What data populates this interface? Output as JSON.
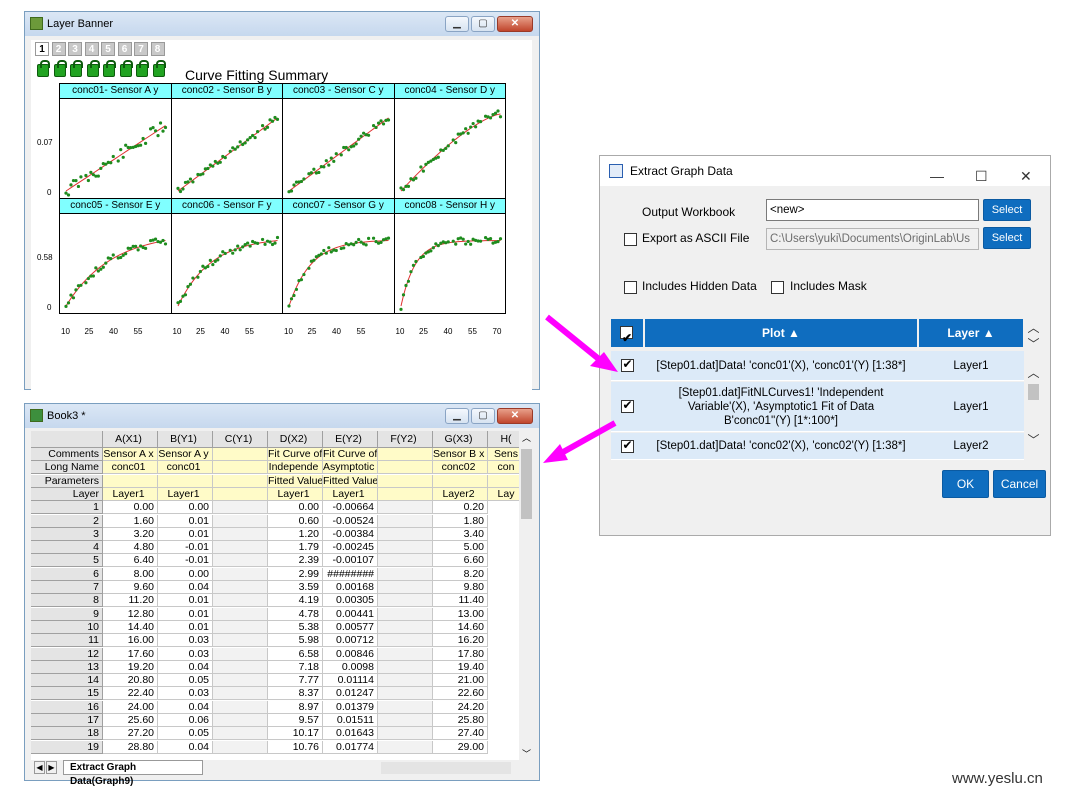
{
  "graph_window": {
    "title": "Layer Banner",
    "layer_tabs": [
      "1",
      "2",
      "3",
      "4",
      "5",
      "6",
      "7",
      "8"
    ],
    "chart_title": "Curve Fitting Summary"
  },
  "chart_data": {
    "type": "scatter",
    "title": "Curve Fitting Summary",
    "panels": [
      {
        "name": "conc01- Sensor A y",
        "row": 1
      },
      {
        "name": "conc02 - Sensor B y",
        "row": 1
      },
      {
        "name": "conc03 - Sensor C y",
        "row": 1
      },
      {
        "name": "conc04 - Sensor D y",
        "row": 1
      },
      {
        "name": "conc05 - Sensor E y",
        "row": 2
      },
      {
        "name": "conc06 - Sensor F y",
        "row": 2
      },
      {
        "name": "conc07 - Sensor G y",
        "row": 2
      },
      {
        "name": "conc08 - Sensor H y",
        "row": 2
      }
    ],
    "row1_yticks": [
      "0.07",
      "0"
    ],
    "row2_yticks": [
      "0.58",
      "0"
    ],
    "xticks": [
      "10",
      "25",
      "40",
      "55",
      "70"
    ],
    "series_colors": {
      "points": "#1e8c1e",
      "fit": "#e03030"
    }
  },
  "dialog": {
    "title": "Extract Graph Data",
    "output_workbook_label": "Output Workbook",
    "output_workbook_value": "<new>",
    "select_label": "Select",
    "export_ascii_label": "Export as ASCII File",
    "ascii_path": "C:\\Users\\yuki\\Documents\\OriginLab\\Us",
    "hidden_data_label": "Includes Hidden Data",
    "mask_label": "Includes Mask",
    "col_plot": "Plot",
    "col_layer": "Layer",
    "rows": [
      {
        "plot": "[Step01.dat]Data! 'conc01'(X), 'conc01'(Y) [1:38*]",
        "layer": "Layer1",
        "checked": true
      },
      {
        "plot": "[Step01.dat]FitNLCurves1! 'Independent Variable'(X), 'Asymptotic1 Fit of Data B'conc01''(Y) [1*:100*]",
        "layer": "Layer1",
        "checked": true
      },
      {
        "plot": "[Step01.dat]Data! 'conc02'(X), 'conc02'(Y) [1:38*]",
        "layer": "Layer2",
        "checked": true
      }
    ],
    "ok_label": "OK",
    "cancel_label": "Cancel"
  },
  "book": {
    "title": "Book3 *",
    "columns": [
      "A(X1)",
      "B(Y1)",
      "C(Y1)",
      "D(X2)",
      "E(Y2)",
      "F(Y2)",
      "G(X3)",
      "H("
    ],
    "meta_rows": [
      {
        "label": "Comments",
        "cells": [
          "Sensor A x",
          "Sensor A y",
          "",
          "Fit Curve of",
          "Fit Curve of",
          "",
          "Sensor B x",
          "Sens"
        ]
      },
      {
        "label": "Long Name",
        "cells": [
          "conc01",
          "conc01",
          "",
          "Independe",
          "Asymptotic",
          "",
          "conc02",
          "con"
        ]
      },
      {
        "label": "Parameters",
        "cells": [
          "",
          "",
          "",
          "Fitted Values",
          "Fitted Values",
          "",
          "",
          ""
        ]
      },
      {
        "label": "Layer",
        "cells": [
          "Layer1",
          "Layer1",
          "",
          "Layer1",
          "Layer1",
          "",
          "Layer2",
          "Lay"
        ]
      }
    ],
    "rows": [
      [
        "1",
        "0.00",
        "0.00",
        "",
        "0.00",
        "-0.00664",
        "",
        "0.20"
      ],
      [
        "2",
        "1.60",
        "0.01",
        "",
        "0.60",
        "-0.00524",
        "",
        "1.80"
      ],
      [
        "3",
        "3.20",
        "0.01",
        "",
        "1.20",
        "-0.00384",
        "",
        "3.40"
      ],
      [
        "4",
        "4.80",
        "-0.01",
        "",
        "1.79",
        "-0.00245",
        "",
        "5.00"
      ],
      [
        "5",
        "6.40",
        "-0.01",
        "",
        "2.39",
        "-0.00107",
        "",
        "6.60"
      ],
      [
        "6",
        "8.00",
        "0.00",
        "",
        "2.99",
        "########",
        "",
        "8.20"
      ],
      [
        "7",
        "9.60",
        "0.04",
        "",
        "3.59",
        "0.00168",
        "",
        "9.80"
      ],
      [
        "8",
        "11.20",
        "0.01",
        "",
        "4.19",
        "0.00305",
        "",
        "11.40"
      ],
      [
        "9",
        "12.80",
        "0.01",
        "",
        "4.78",
        "0.00441",
        "",
        "13.00"
      ],
      [
        "10",
        "14.40",
        "0.01",
        "",
        "5.38",
        "0.00577",
        "",
        "14.60"
      ],
      [
        "11",
        "16.00",
        "0.03",
        "",
        "5.98",
        "0.00712",
        "",
        "16.20"
      ],
      [
        "12",
        "17.60",
        "0.03",
        "",
        "6.58",
        "0.00846",
        "",
        "17.80"
      ],
      [
        "13",
        "19.20",
        "0.04",
        "",
        "7.18",
        "0.0098",
        "",
        "19.40"
      ],
      [
        "14",
        "20.80",
        "0.05",
        "",
        "7.77",
        "0.01114",
        "",
        "21.00"
      ],
      [
        "15",
        "22.40",
        "0.03",
        "",
        "8.37",
        "0.01247",
        "",
        "22.60"
      ],
      [
        "16",
        "24.00",
        "0.04",
        "",
        "8.97",
        "0.01379",
        "",
        "24.20"
      ],
      [
        "17",
        "25.60",
        "0.06",
        "",
        "9.57",
        "0.01511",
        "",
        "25.80"
      ],
      [
        "18",
        "27.20",
        "0.05",
        "",
        "10.17",
        "0.01643",
        "",
        "27.40"
      ],
      [
        "19",
        "28.80",
        "0.04",
        "",
        "10.76",
        "0.01774",
        "",
        "29.00"
      ]
    ],
    "sheet_tab": "Extract Graph Data(Graph9)"
  },
  "watermark": "www.yeslu.cn"
}
